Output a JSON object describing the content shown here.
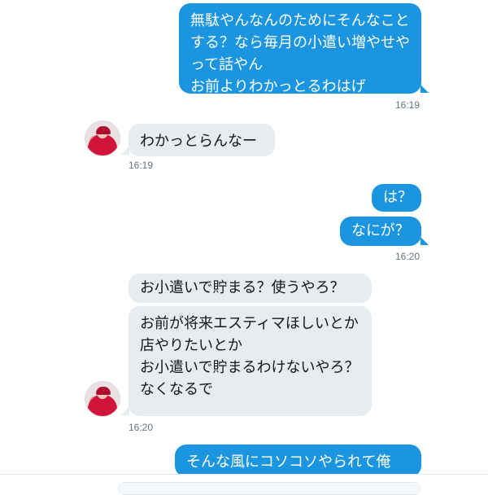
{
  "messages": [
    {
      "text": "無駄やんなんのためにそんなことする？なら毎月の小遣い増やせやって話やん\nお前よりわかっとるわはげ"
    },
    {
      "text": "わかっとらんなー"
    },
    {
      "text": "は？"
    },
    {
      "text": "なにが？"
    },
    {
      "text": "お小遣いで貯まる？使うやろ？"
    },
    {
      "text": "お前が将来エスティマほしいとか\n店やりたいとか\nお小遣いで貯まるわけないやろ？なくなるで"
    },
    {
      "text": "そんな風にコソコソやられて俺"
    }
  ],
  "timestamps": {
    "t1": "16:19",
    "t2": "16:19",
    "t3": "16:20",
    "t4": "16:20"
  },
  "colors": {
    "outgoing": "#1b95e0",
    "incoming": "#e6ecf0",
    "timestamp": "#657786"
  },
  "icons": {
    "avatar": "user-avatar"
  }
}
